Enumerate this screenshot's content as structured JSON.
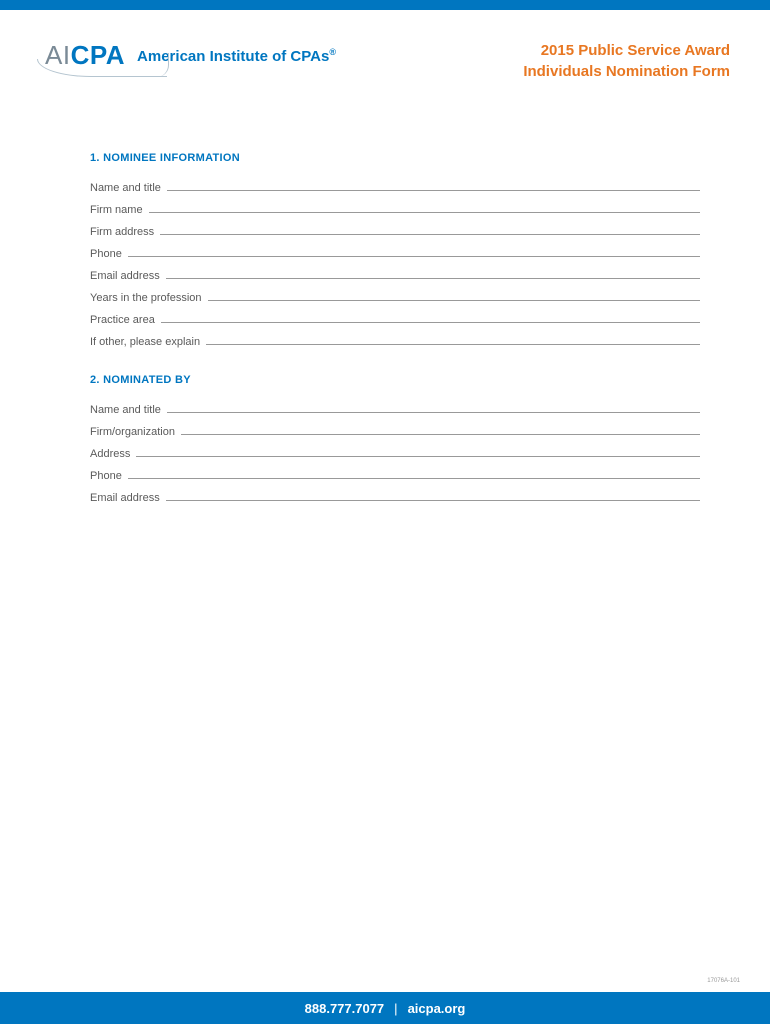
{
  "header": {
    "logo_ai": "AI",
    "logo_cpa": "CPA",
    "logo_text": "American Institute of CPAs",
    "title_line1": "2015 Public Service Award",
    "title_line2": "Individuals Nomination Form"
  },
  "sections": {
    "nominee": {
      "heading": "1. NOMINEE INFORMATION",
      "fields": [
        "Name and title",
        "Firm name",
        "Firm address",
        "Phone",
        "Email address",
        "Years in the profession",
        "Practice area",
        "If other, please explain"
      ]
    },
    "nominated_by": {
      "heading": "2. NOMINATED BY",
      "fields": [
        "Name and title",
        "Firm/organization",
        "Address",
        "Phone",
        "Email address"
      ]
    }
  },
  "footer": {
    "code": "17076A-101",
    "phone": "888.777.7077",
    "sep": "|",
    "url": "aicpa.org"
  }
}
